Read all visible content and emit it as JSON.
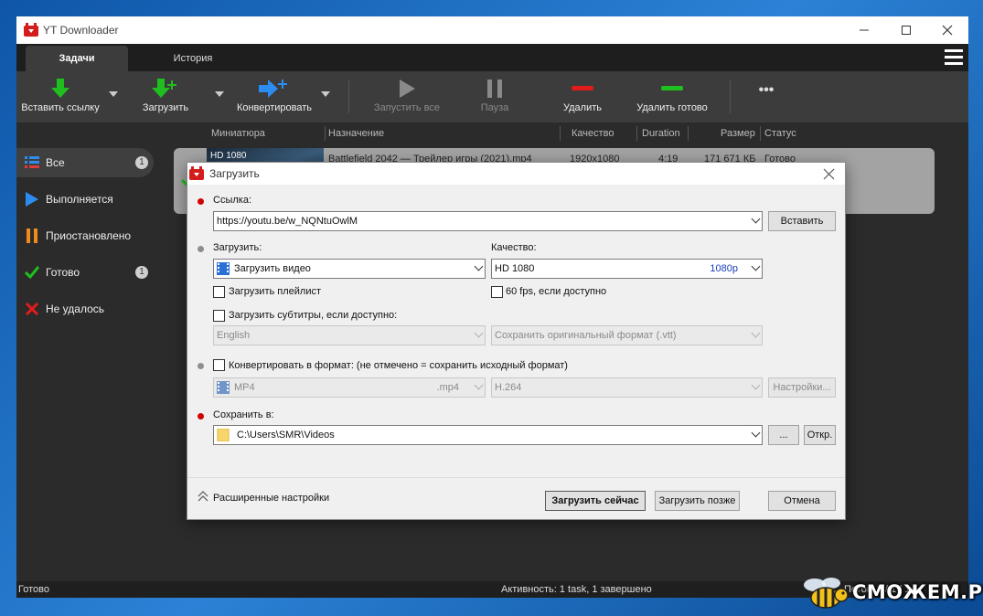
{
  "window": {
    "title": "YT Downloader"
  },
  "tabs": [
    "Задачи",
    "История"
  ],
  "toolbar": {
    "paste_link": "Вставить ссылку",
    "download": "Загрузить",
    "convert": "Конвертировать",
    "start_all": "Запустить все",
    "pause": "Пауза",
    "delete": "Удалить",
    "delete_done": "Удалить готово",
    "more": "•••"
  },
  "columns": {
    "thumbnail": "Миниатюра",
    "name": "Назначение",
    "quality": "Качество",
    "duration": "Duration",
    "size": "Размер",
    "status": "Статус"
  },
  "sidebar": {
    "items": [
      {
        "label": "Все",
        "badge": "1",
        "icon": "list-icon"
      },
      {
        "label": "Выполняется",
        "badge": "",
        "icon": "play-icon"
      },
      {
        "label": "Приостановлено",
        "badge": "",
        "icon": "pause-icon"
      },
      {
        "label": "Готово",
        "badge": "1",
        "icon": "check-icon"
      },
      {
        "label": "Не удалось",
        "badge": "",
        "icon": "cross-icon"
      }
    ]
  },
  "task": {
    "thumb_label": "HD 1080",
    "name": "Battlefield 2042 — Трейлер игры (2021).mp4",
    "quality": "1920x1080",
    "duration": "4:19",
    "size": "171 671 КБ",
    "status": "Готово"
  },
  "statusbar": {
    "left": "Готово",
    "center": "Активность: 1 task, 1 завершено",
    "right": "Поток: 1 / 1 / 1"
  },
  "dialog": {
    "title": "Загрузить",
    "link_label": "Ссылка:",
    "link_value": "https://youtu.be/w_NQNtuOwlM",
    "paste_button": "Вставить",
    "download_label": "Загрузить:",
    "download_value": "Загрузить видео",
    "quality_label": "Качество:",
    "quality_value": "HD 1080",
    "quality_short": "1080p",
    "playlist_label": "Загрузить плейлист",
    "fps_label": "60 fps, если доступно",
    "subtitles_label": "Загрузить субтитры, если доступно:",
    "subtitle_lang": "English",
    "subtitle_format": "Сохранить оригинальный формат (.vtt)",
    "convert_label": "Конвертировать в формат: (не отмечено = сохранить исходный формат)",
    "format_value": "MP4",
    "format_ext": ".mp4",
    "codec_value": "H.264",
    "settings_button": "Настройки...",
    "save_label": "Сохранить в:",
    "save_path": "C:\\Users\\SMR\\Videos",
    "browse_button": "...",
    "open_button": "Откр.",
    "advanced_label": "Расширенные настройки",
    "download_now": "Загрузить сейчас",
    "download_later": "Загрузить позже",
    "cancel": "Отмена"
  },
  "watermark": {
    "text": "СМОЖЕМ.РУ"
  },
  "colors": {
    "accent_red": "#d20000",
    "green": "#1fbf1f",
    "blue": "#2d8cf0"
  }
}
